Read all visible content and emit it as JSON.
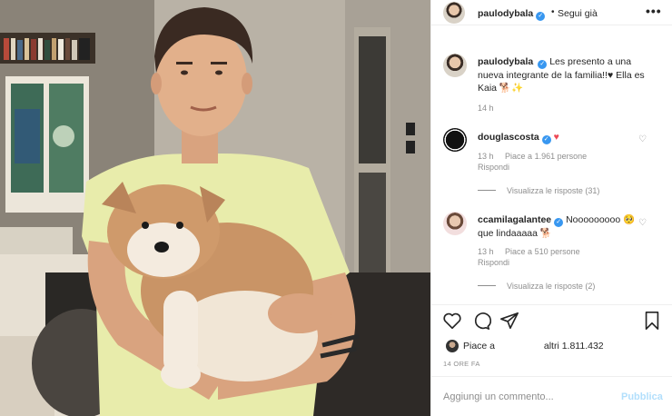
{
  "post": {
    "author": "paulodybala",
    "follow_label": "Segui già",
    "dot": "•",
    "more_label": "•••",
    "caption": "Les presento a una nueva integrante de la familia!!♥ Ella es Kaia 🐕✨",
    "caption_time": "14 h",
    "likes_prefix": "Piace a",
    "likes_suffix": "altri 1.811.432",
    "posted_ago": "14 ORE FA"
  },
  "comments": [
    {
      "user": "douglascosta",
      "text": "",
      "heart": "♥",
      "time": "13 h",
      "likes": "Piace a 1.961 persone",
      "reply": "Rispondi",
      "view_replies": "Visualizza le risposte (31)"
    },
    {
      "user": "ccamilagalantee",
      "text": "Nooooooooo 🥺 que lindaaaaa 🐕",
      "time": "13 h",
      "likes": "Piace a 510 persone",
      "reply": "Rispondi",
      "view_replies": "Visualizza le risposte (2)"
    }
  ],
  "composer": {
    "placeholder": "Aggiungi un commento...",
    "publish_label": "Pubblica"
  },
  "icons": {
    "verified": "✓",
    "like": "heart-icon",
    "comment": "comment-icon",
    "share": "share-icon",
    "save": "bookmark-icon"
  },
  "colors": {
    "verified_blue": "#3897f0",
    "heart_red": "#ed4956",
    "publish_disabled": "#b2dffc",
    "muted_text": "#8e8e8e"
  }
}
